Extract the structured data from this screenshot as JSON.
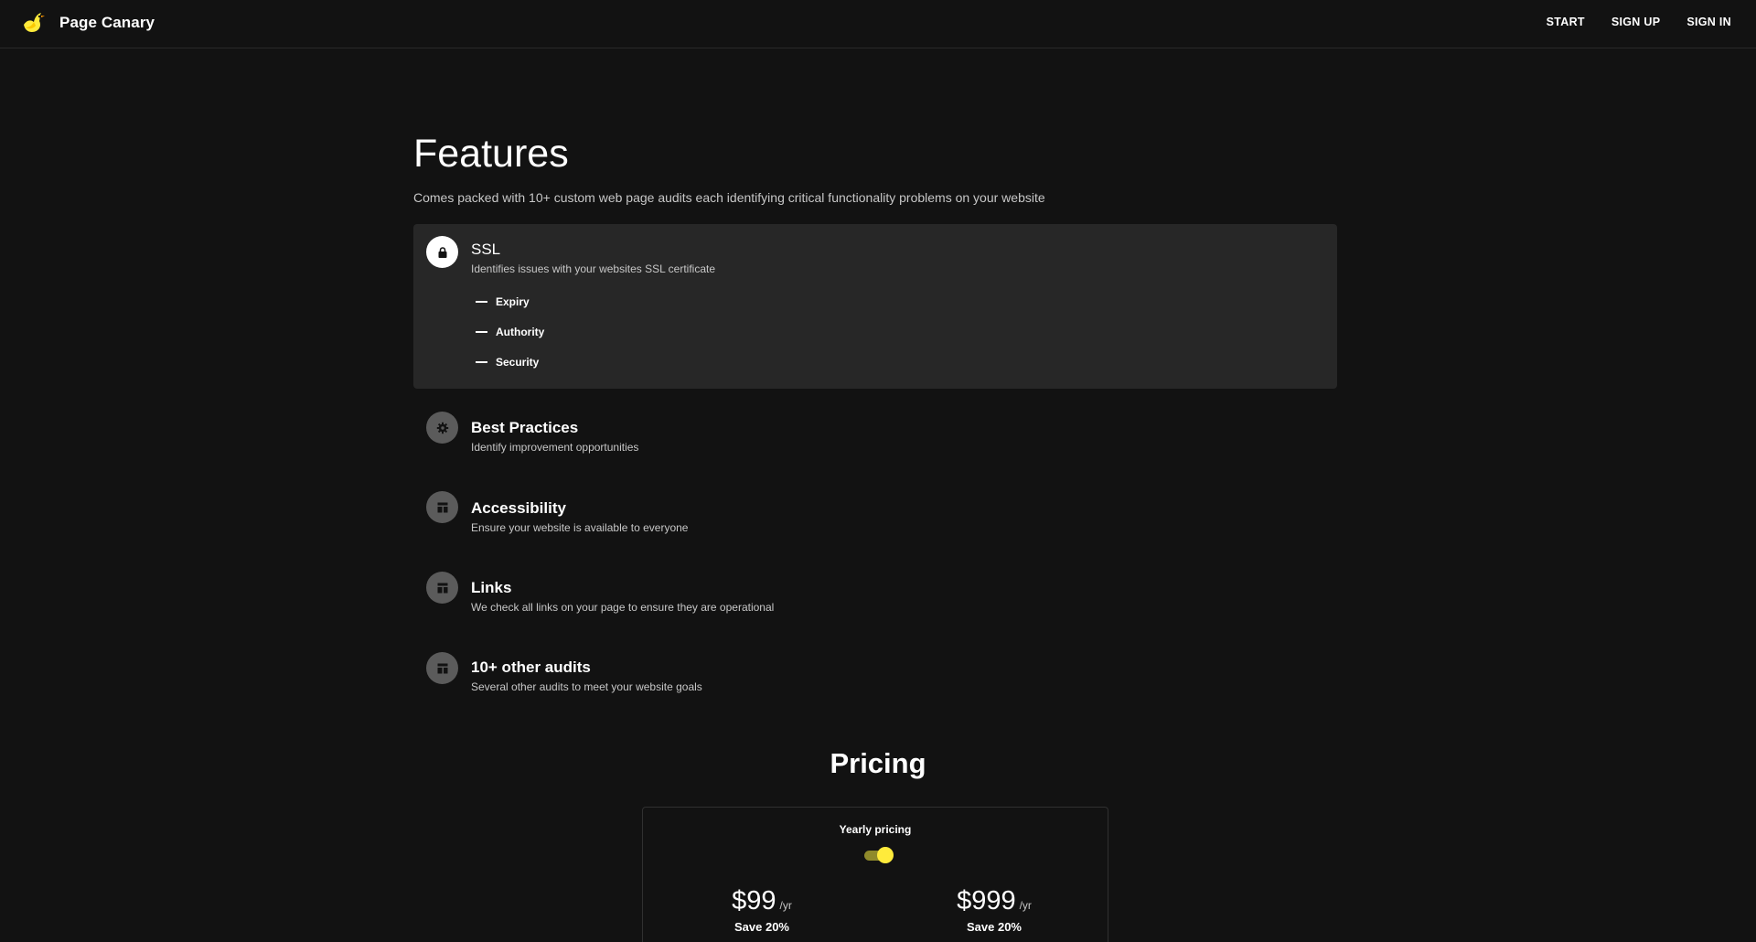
{
  "brand": {
    "name": "Page Canary",
    "logo_icon": "canary-bird-icon",
    "accent_color": "#ffeb3b"
  },
  "nav": {
    "start": "START",
    "sign_up": "SIGN UP",
    "sign_in": "SIGN IN"
  },
  "features": {
    "title": "Features",
    "subtitle": "Comes packed with 10+ custom web page audits each identifying critical functionality problems on your website",
    "items": [
      {
        "title": "SSL",
        "description": "Identifies issues with your websites SSL certificate",
        "icon": "lock-icon",
        "expanded": true,
        "subitems": [
          "Expiry",
          "Authority",
          "Security"
        ]
      },
      {
        "title": "Best Practices",
        "description": "Identify improvement opportunities",
        "icon": "gear-icon",
        "expanded": false
      },
      {
        "title": "Accessibility",
        "description": "Ensure your website is available to everyone",
        "icon": "layout-icon",
        "expanded": false
      },
      {
        "title": "Links",
        "description": "We check all links on your page to ensure they are operational",
        "icon": "layout-icon",
        "expanded": false
      },
      {
        "title": "10+ other audits",
        "description": "Several other audits to meet your website goals",
        "icon": "layout-icon",
        "expanded": false
      }
    ]
  },
  "pricing": {
    "title": "Pricing",
    "toggle_label": "Yearly pricing",
    "yearly_enabled": true,
    "plans": [
      {
        "price": "$99",
        "unit": "/yr",
        "save": "Save 20%"
      },
      {
        "price": "$999",
        "unit": "/yr",
        "save": "Save 20%"
      }
    ]
  }
}
